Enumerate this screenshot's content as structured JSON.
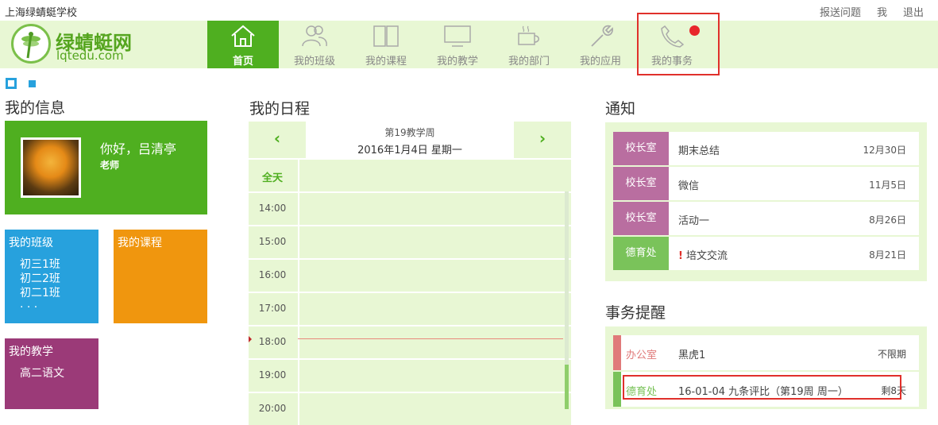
{
  "topbar": {
    "school": "上海绿蜻蜓学校",
    "links": [
      "报送问题",
      "我",
      "退出"
    ]
  },
  "logo": {
    "name": "绿蜻蜓网",
    "domain": "lqtedu.com"
  },
  "nav": {
    "items": [
      {
        "label": "首页",
        "icon": "home-icon",
        "active": true
      },
      {
        "label": "我的班级",
        "icon": "users-icon"
      },
      {
        "label": "我的课程",
        "icon": "book-icon"
      },
      {
        "label": "我的教学",
        "icon": "monitor-icon"
      },
      {
        "label": "我的部门",
        "icon": "cup-icon"
      },
      {
        "label": "我的应用",
        "icon": "wrench-icon"
      },
      {
        "label": "我的事务",
        "icon": "phone-icon",
        "has_notification": true
      }
    ]
  },
  "myinfo": {
    "title": "我的信息",
    "greeting": "你好，吕清亭",
    "role": "老师",
    "tiles": {
      "classes": {
        "title": "我的班级",
        "items": [
          "初三1班",
          "初二2班",
          "初二1班",
          "·  ·  ·"
        ],
        "color": "#27a1dd"
      },
      "courses": {
        "title": "我的课程",
        "color": "#f0960e"
      },
      "teaching": {
        "title": "我的教学",
        "items": [
          "高二语文"
        ],
        "color": "#9b3a78"
      }
    }
  },
  "schedule": {
    "title": "我的日程",
    "week": "第19教学周",
    "date": "2016年1月4日  星期一",
    "prev": "‹",
    "next": "›",
    "allday": "全天",
    "hours": [
      "14:00",
      "15:00",
      "16:00",
      "17:00",
      "18:00",
      "19:00",
      "20:00"
    ]
  },
  "notices": {
    "title": "通知",
    "items": [
      {
        "dept": "校长室",
        "text": "期末总结",
        "date": "12月30日",
        "color": "#b96ea0"
      },
      {
        "dept": "校长室",
        "text": "微信",
        "date": "11月5日",
        "color": "#b96ea0"
      },
      {
        "dept": "校长室",
        "text": "活动一",
        "date": "8月26日",
        "color": "#b96ea0"
      },
      {
        "dept": "德育处",
        "text": "培文交流",
        "date": "8月21日",
        "color": "#7ac35a",
        "important": "!"
      }
    ]
  },
  "reminders": {
    "title": "事务提醒",
    "items": [
      {
        "dept": "办公室",
        "text": "黑虎1",
        "due": "不限期",
        "color": "#e07a7a"
      },
      {
        "dept": "德育处",
        "text": "16-01-04 九条评比（第19周 周一）",
        "due": "剩8天",
        "color": "#7ac35a"
      }
    ]
  },
  "colors": {
    "brand_green": "#4faf20",
    "nav_bg": "#e8f7d4",
    "highlight_red": "#e0302b"
  }
}
